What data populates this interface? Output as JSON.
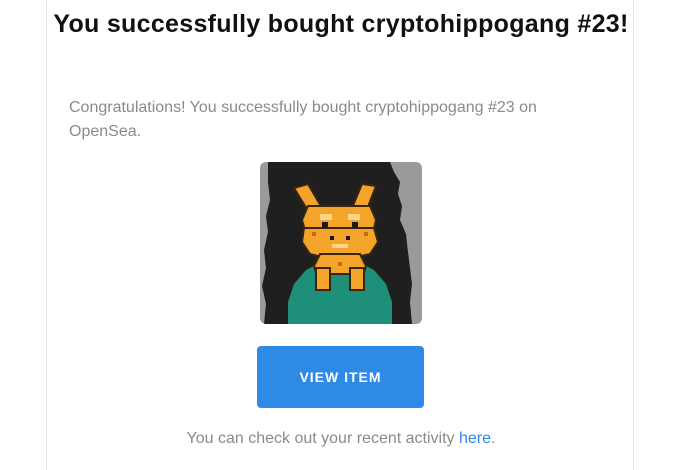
{
  "email": {
    "title": "You successfully bought cryptohippogang #23!",
    "message": "Congratulations! You successfully bought cryptohippogang #23 on OpenSea.",
    "image_alt": "cryptohippogang #23",
    "button_label": "VIEW ITEM",
    "activity_prefix": "You can check out your recent activity ",
    "activity_link": "here",
    "activity_suffix": "."
  },
  "colors": {
    "button": "#2f8ae6",
    "link": "#2f8ae6",
    "body_text": "#8a8a8a",
    "title_text": "#111111",
    "nft_background": "#1f1f1f",
    "nft_body": "#f4a32b",
    "nft_hill": "#1e8f79"
  }
}
